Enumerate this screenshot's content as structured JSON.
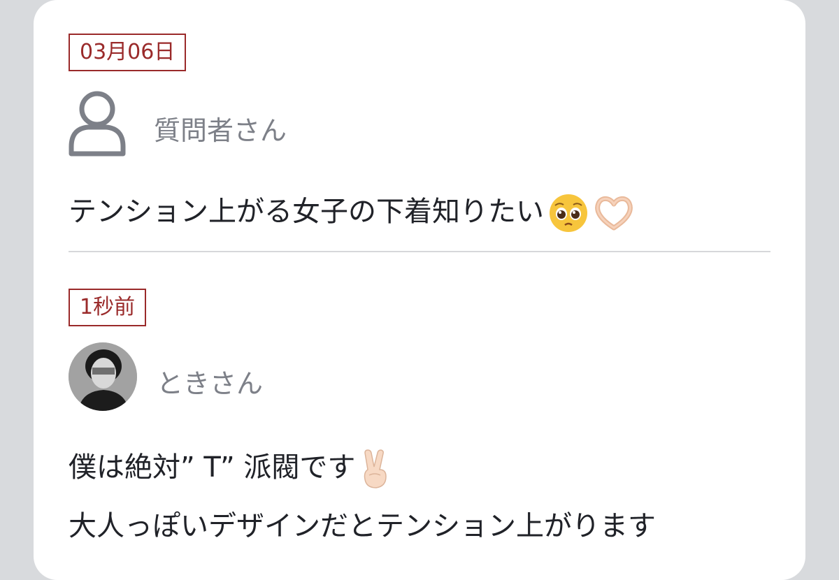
{
  "question": {
    "date": "03月06日",
    "author": "質問者さん",
    "text": "テンション上がる女子の下着知りたい",
    "emojis": [
      "pleading-face",
      "heart-hands"
    ]
  },
  "answer": {
    "time": "1秒前",
    "author": "ときさん",
    "line1": "僕は絶対” T” 派閥です",
    "line1_emoji": "victory-hand",
    "line2": "大人っぽいデザインだとテンション上がります"
  },
  "colors": {
    "badge": "#9a2a2a",
    "name": "#7d8088",
    "text": "#202228",
    "background": "#d8dadd",
    "card": "#ffffff"
  }
}
